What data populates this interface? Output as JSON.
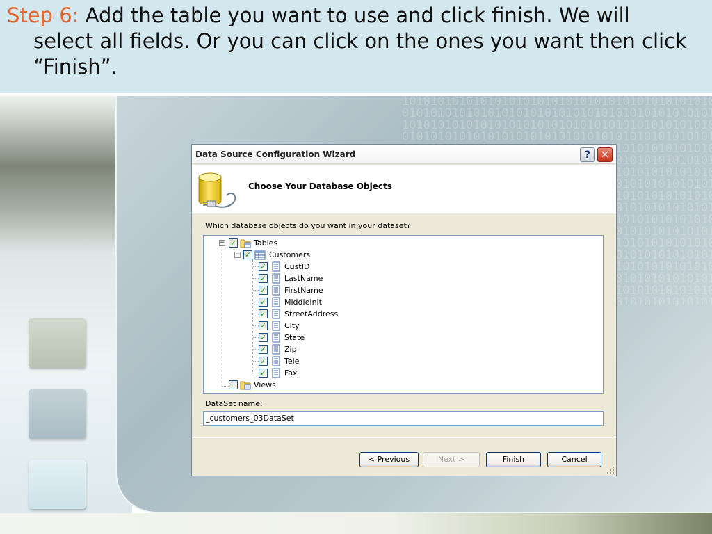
{
  "slide": {
    "step_label": "Step 6:",
    "instruction": "Add the table you want to use and click finish. We will select all fields. Or you can click on the ones you want then click “Finish”."
  },
  "dialog": {
    "title": "Data Source Configuration Wizard",
    "help_glyph": "?",
    "close_glyph": "✕",
    "heading": "Choose Your Database Objects",
    "question": "Which database objects do you want in your dataset?",
    "tree": {
      "root": {
        "label": "Tables",
        "checked": true,
        "expanded": true
      },
      "table": {
        "label": "Customers",
        "checked": true,
        "expanded": true
      },
      "fields": [
        "CustID",
        "LastName",
        "FirstName",
        "MiddleInit",
        "StreetAddress",
        "City",
        "State",
        "Zip",
        "Tele",
        "Fax"
      ],
      "views": {
        "label": "Views",
        "checked": false
      }
    },
    "dataset_name_label": "DataSet name:",
    "dataset_name_value": "_customers_03DataSet",
    "buttons": {
      "previous": "< Previous",
      "next": "Next >",
      "finish": "Finish",
      "cancel": "Cancel"
    }
  },
  "colors": {
    "step_label": "#e8642a",
    "header_bg": "#d3e7ee",
    "dialog_bg": "#ece9d8",
    "checkmark": "#21a121"
  }
}
